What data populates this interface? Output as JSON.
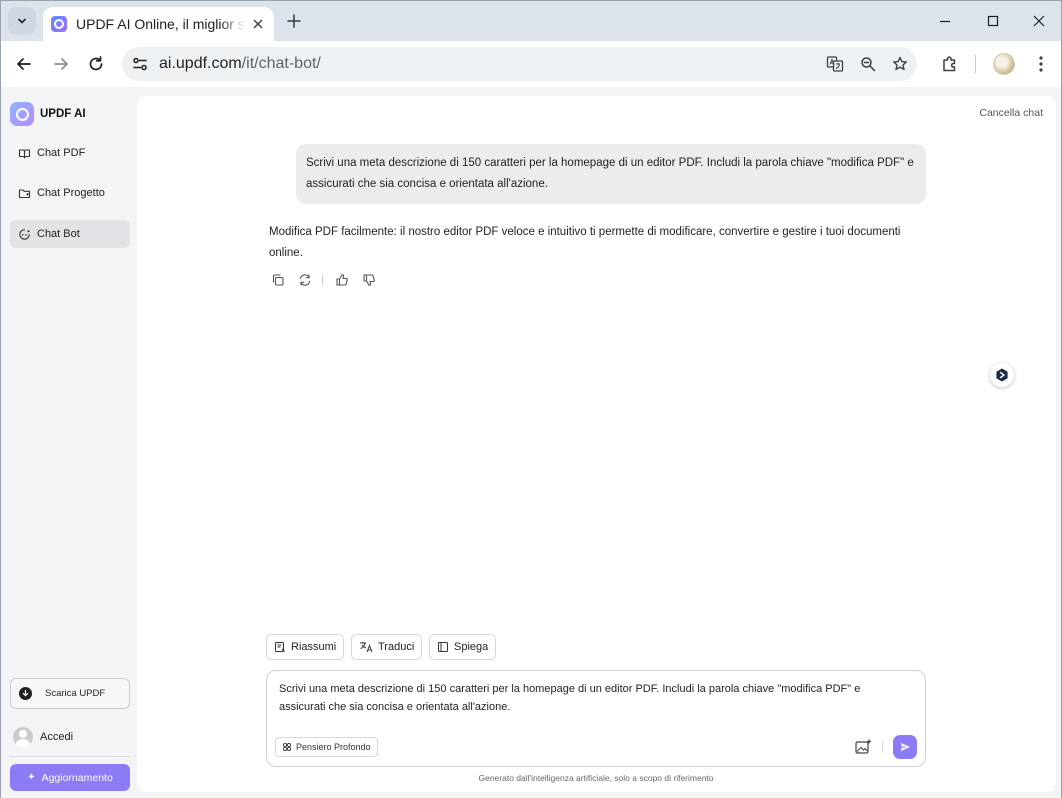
{
  "browser": {
    "tab_title": "UPDF AI Online, il miglior strumento di chat AI",
    "url_domain": "ai.updf.com",
    "url_path": "/it/chat-bot/"
  },
  "sidebar": {
    "brand": "UPDF AI",
    "items": [
      {
        "label": "Chat PDF",
        "icon": "book-open-icon"
      },
      {
        "label": "Chat Progetto",
        "icon": "folder-icon"
      },
      {
        "label": "Chat Bot",
        "icon": "chat-bot-icon",
        "active": true
      }
    ],
    "download_label": "Scarica UPDF",
    "login_label": "Accedi",
    "upgrade_label": "Aggiornamento"
  },
  "chat": {
    "clear_label": "Cancella chat",
    "user_message": "Scrivi una meta descrizione di 150 caratteri per la homepage di un editor PDF. Includi la parola chiave \"modifica PDF\" e assicurati che sia concisa e orientata all'azione.",
    "ai_message": "Modifica PDF facilmente: il nostro editor PDF veloce e intuitivo ti permette di modificare, convertire e gestire i tuoi documenti online.",
    "actions": [
      "copy-icon",
      "regenerate-icon",
      "thumbs-up-icon",
      "thumbs-down-icon"
    ]
  },
  "composer": {
    "quick_actions": [
      {
        "label": "Riassumi",
        "icon": "summarize-icon"
      },
      {
        "label": "Traduci",
        "icon": "translate-icon"
      },
      {
        "label": "Spiega",
        "icon": "explain-book-icon"
      }
    ],
    "input_value": "Scrivi una meta descrizione di 150 caratteri per la homepage di un editor PDF. Includi la parola chiave \"modifica PDF\" e assicurati che sia concisa e orientata all'azione.",
    "deep_think_label": "Pensiero Profondo",
    "disclaimer": "Generato dall'intelligenza artificiale, solo a scopo di riferimento"
  },
  "colors": {
    "accent": "#8b7cf6",
    "active_item_bg": "#e2e3e6",
    "bubble_bg": "#ececee"
  }
}
